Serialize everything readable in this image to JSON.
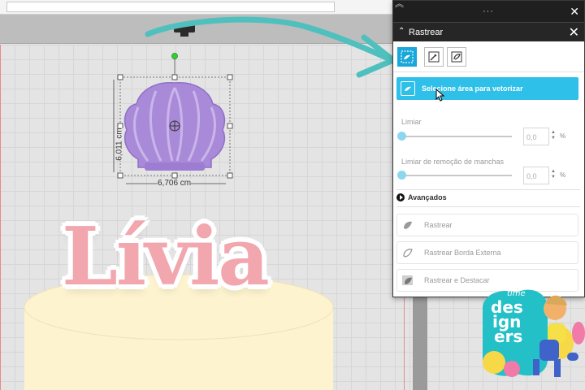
{
  "panel": {
    "title": "Rastrear",
    "select_area_label": "Selecione área para vetorizar",
    "threshold": {
      "label": "Limiar",
      "value": "0,0",
      "unit": "%",
      "level": 0
    },
    "stain_removal": {
      "label": "Limiar de remoção de manchas",
      "value": "0,0",
      "unit": "%",
      "level": 0
    },
    "advanced_label": "Avançados",
    "actions": [
      {
        "label": "Rastrear"
      },
      {
        "label": "Rastrear Borda Externa"
      },
      {
        "label": "Rastrear e Destacar"
      }
    ]
  },
  "canvas": {
    "width_label": "6,706 cm",
    "height_label": "6,011 cm",
    "name_text": "Lívia"
  },
  "logo": {
    "line1": "time",
    "line2": "des",
    "line3": "ign",
    "line4": "ers"
  },
  "colors": {
    "accent": "#2ec0e8",
    "shell": "#a98ad8",
    "name_pink": "#f2a6ae",
    "cake": "#fdf3cf",
    "arrow": "#4fc0bd"
  }
}
